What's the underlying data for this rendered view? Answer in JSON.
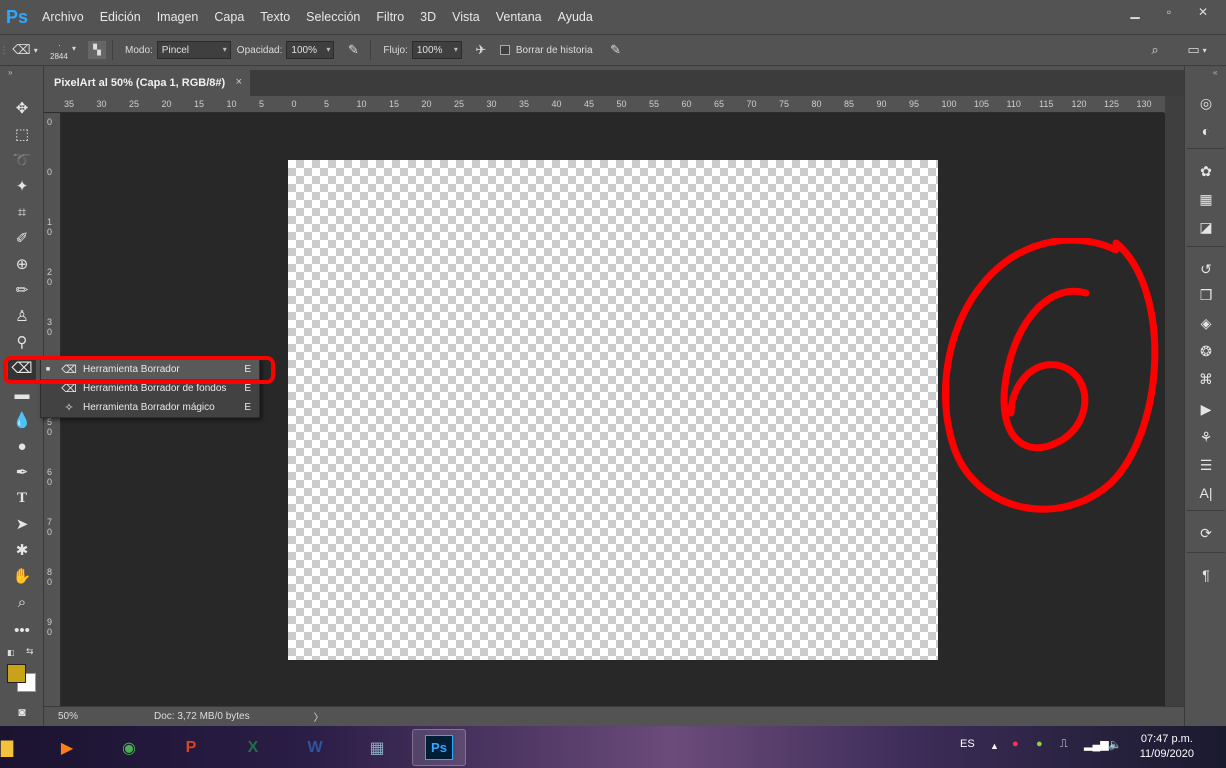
{
  "app": {
    "logo": "Ps"
  },
  "menu": [
    "Archivo",
    "Edición",
    "Imagen",
    "Capa",
    "Texto",
    "Selección",
    "Filtro",
    "3D",
    "Vista",
    "Ventana",
    "Ayuda"
  ],
  "options": {
    "brush_size": "2844",
    "mode_label": "Modo:",
    "mode_value": "Pincel",
    "opacity_label": "Opacidad:",
    "opacity_value": "100%",
    "flow_label": "Flujo:",
    "flow_value": "100%",
    "history_label": "Borrar de historia"
  },
  "tab": {
    "title": "PixelArt al 50% (Capa 1, RGB/8#)",
    "close": "×"
  },
  "ruler_top": [
    "35",
    "30",
    "25",
    "20",
    "15",
    "10",
    "5",
    "0",
    "5",
    "10",
    "15",
    "20",
    "25",
    "30",
    "35",
    "40",
    "45",
    "50",
    "55",
    "60",
    "65",
    "70",
    "75",
    "80",
    "85",
    "90",
    "95",
    "100",
    "105",
    "110",
    "115",
    "120",
    "125",
    "130"
  ],
  "ruler_left": [
    "0",
    "0",
    "1 0",
    "2 0",
    "3 0",
    "4 0",
    "5 0",
    "6 0",
    "7 0",
    "8 0",
    "9 0"
  ],
  "flyout": [
    {
      "label": "Herramienta Borrador",
      "key": "E",
      "bullet": "■",
      "selected": true
    },
    {
      "label": "Herramienta Borrador de fondos",
      "key": "E",
      "bullet": "",
      "selected": false
    },
    {
      "label": "Herramienta Borrador mágico",
      "key": "E",
      "bullet": "",
      "selected": false
    }
  ],
  "annotation": {
    "text": "6",
    "color": "#ff0000"
  },
  "status": {
    "zoom": "50%",
    "doc": "Doc: 3,72 MB/0 bytes",
    "arrow": "〉"
  },
  "taskbar": {
    "language": "ES",
    "time": "07:47 p.m.",
    "date": "11/09/2020",
    "apps": [
      {
        "name": "file-explorer",
        "glyph": "▇"
      },
      {
        "name": "media-player",
        "glyph": "▶"
      },
      {
        "name": "chrome",
        "glyph": "◉"
      },
      {
        "name": "powerpoint",
        "glyph": "P"
      },
      {
        "name": "excel",
        "glyph": "X"
      },
      {
        "name": "word",
        "glyph": "W"
      },
      {
        "name": "calculator",
        "glyph": "▦"
      },
      {
        "name": "photoshop",
        "glyph": "Ps"
      }
    ]
  }
}
